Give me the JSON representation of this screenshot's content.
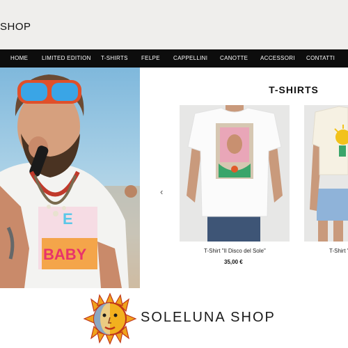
{
  "header": {
    "shop_title": "SHOP"
  },
  "nav": {
    "items": [
      {
        "label": "HOME"
      },
      {
        "label": "LIMITED EDITION"
      },
      {
        "label": "T-SHIRTS"
      },
      {
        "label": "FELPE"
      },
      {
        "label": "CAPPELLINI"
      },
      {
        "label": "CANOTTE"
      },
      {
        "label": "ACCESSORI"
      },
      {
        "label": "CONTATTI"
      }
    ]
  },
  "hero": {
    "shirt_text_1": "BABY",
    "shirt_text_2": "E"
  },
  "section": {
    "title": "T-SHIRTS",
    "prev_arrow": "‹"
  },
  "products": [
    {
      "name": "T-Shirt \"Il Disco del Sole\"",
      "price": "35,00 €"
    },
    {
      "name": "T-Shirt \""
    }
  ],
  "brand": {
    "name": "SOLELUNA SHOP"
  },
  "colors": {
    "nav_bg": "#0d0d0d",
    "topbar_bg": "#efeeec",
    "sun": "#f0a21b",
    "sun_dark": "#c0361a",
    "moon": "#1f5fa8"
  },
  "icons": {
    "prev": "chevron-left-icon",
    "logo": "sun-moon-logo"
  }
}
